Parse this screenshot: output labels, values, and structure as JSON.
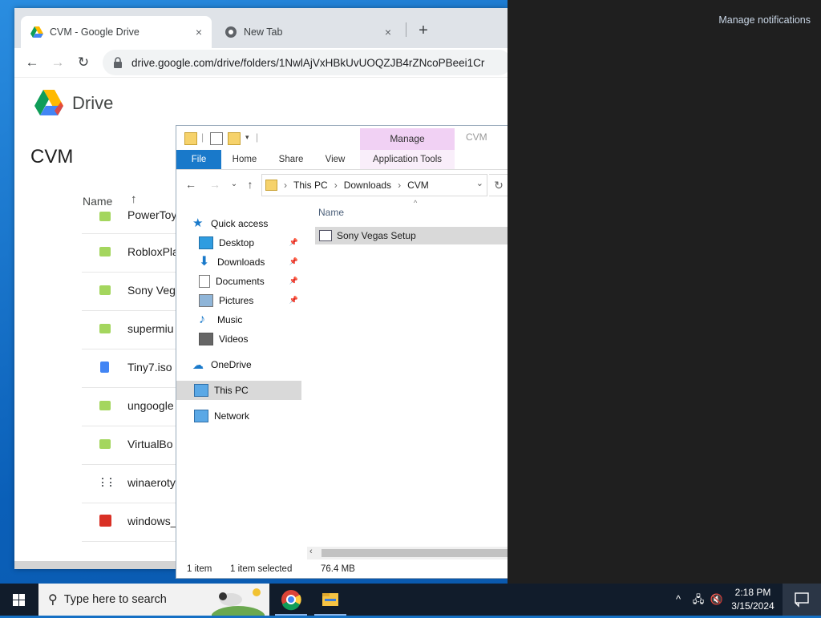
{
  "chrome": {
    "tabs": [
      {
        "title": "CVM - Google Drive",
        "close": "×"
      },
      {
        "title": "New Tab",
        "close": "×"
      }
    ],
    "new_tab": "+",
    "url": "drive.google.com/drive/folders/1NwlAjVxHBkUvUOQZJB4rZNcoPBeei1Cr"
  },
  "drive": {
    "brand": "Drive",
    "folder_title": "CVM",
    "name_column": "Name",
    "sort_arrow": "↑",
    "files": [
      {
        "name": "PowerToy",
        "icon": "green-file-icon",
        "color": "#a4d65e"
      },
      {
        "name": "RobloxPla",
        "icon": "green-file-icon",
        "color": "#a4d65e"
      },
      {
        "name": "Sony Veg",
        "icon": "green-file-icon",
        "color": "#a4d65e"
      },
      {
        "name": "supermiu",
        "icon": "green-file-icon",
        "color": "#a4d65e"
      },
      {
        "name": "Tiny7.iso",
        "icon": "blue-doc-icon",
        "color": "#4285f4"
      },
      {
        "name": "ungoogle",
        "icon": "green-file-icon",
        "color": "#a4d65e"
      },
      {
        "name": "VirtualBo",
        "icon": "green-file-icon",
        "color": "#a4d65e"
      },
      {
        "name": "winaeroty",
        "icon": "archive-icon",
        "color": "#5f6368"
      },
      {
        "name": "windows_",
        "icon": "image-file-icon",
        "color": "#d93025"
      }
    ]
  },
  "explorer": {
    "title": "CVM",
    "manage": "Manage",
    "ribbon_tabs": [
      "File",
      "Home",
      "Share",
      "View",
      "Application Tools"
    ],
    "breadcrumb": [
      "This PC",
      "Downloads",
      "CVM"
    ],
    "nav": {
      "quick_access": "Quick access",
      "items": [
        {
          "label": "Desktop",
          "pinned": true
        },
        {
          "label": "Downloads",
          "pinned": true
        },
        {
          "label": "Documents",
          "pinned": true
        },
        {
          "label": "Pictures",
          "pinned": true
        },
        {
          "label": "Music",
          "pinned": false
        },
        {
          "label": "Videos",
          "pinned": false
        }
      ],
      "onedrive": "OneDrive",
      "this_pc": "This PC",
      "network": "Network"
    },
    "column_name": "Name",
    "file": "Sony Vegas Setup",
    "status": {
      "items": "1 item",
      "selected": "1 item selected",
      "size": "76.4 MB"
    }
  },
  "notifications": {
    "manage": "Manage notifications"
  },
  "taskbar": {
    "search_placeholder": "Type here to search",
    "time": "2:18 PM",
    "date": "3/15/2024"
  }
}
